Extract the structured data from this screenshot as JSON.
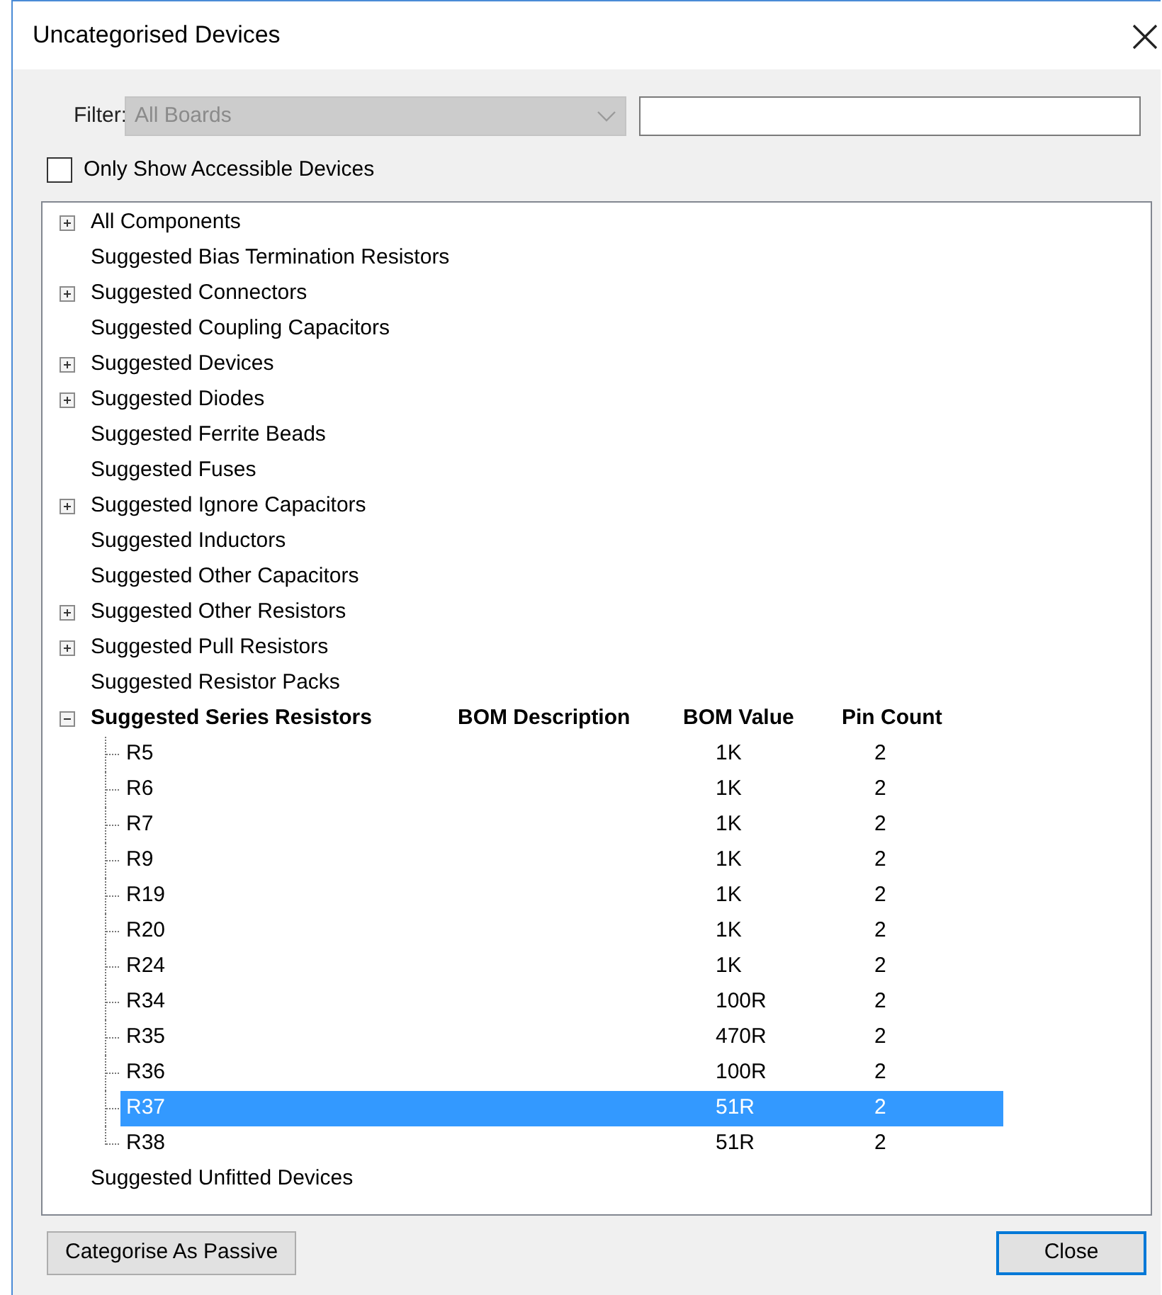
{
  "window": {
    "title": "Uncategorised Devices"
  },
  "filter": {
    "label": "Filter:",
    "board": {
      "value": "All Boards",
      "disabled": true
    }
  },
  "only_accessible": {
    "label": "Only Show Accessible Devices",
    "checked": false
  },
  "tree": {
    "items": [
      {
        "label": "All Components",
        "kind": "expandable",
        "expanded": false
      },
      {
        "label": "Suggested Bias Termination Resistors",
        "kind": "plain"
      },
      {
        "label": "Suggested Connectors",
        "kind": "expandable",
        "expanded": false
      },
      {
        "label": "Suggested Coupling Capacitors",
        "kind": "plain"
      },
      {
        "label": "Suggested Devices",
        "kind": "expandable",
        "expanded": false
      },
      {
        "label": "Suggested Diodes",
        "kind": "expandable",
        "expanded": false
      },
      {
        "label": "Suggested Ferrite Beads",
        "kind": "plain"
      },
      {
        "label": "Suggested Fuses",
        "kind": "plain"
      },
      {
        "label": "Suggested Ignore Capacitors",
        "kind": "expandable",
        "expanded": false
      },
      {
        "label": "Suggested Inductors",
        "kind": "plain"
      },
      {
        "label": "Suggested Other Capacitors",
        "kind": "plain"
      },
      {
        "label": "Suggested Other Resistors",
        "kind": "expandable",
        "expanded": false
      },
      {
        "label": "Suggested Pull Resistors",
        "kind": "expandable",
        "expanded": false
      },
      {
        "label": "Suggested Resistor Packs",
        "kind": "plain"
      },
      {
        "label": "Suggested Series Resistors",
        "kind": "expandable",
        "expanded": true,
        "columns": [
          "BOM Description",
          "BOM Value",
          "Pin Count"
        ],
        "children": [
          {
            "name": "R5",
            "bom_value": "1K",
            "pin_count": "2",
            "selected": false
          },
          {
            "name": "R6",
            "bom_value": "1K",
            "pin_count": "2",
            "selected": false
          },
          {
            "name": "R7",
            "bom_value": "1K",
            "pin_count": "2",
            "selected": false
          },
          {
            "name": "R9",
            "bom_value": "1K",
            "pin_count": "2",
            "selected": false
          },
          {
            "name": "R19",
            "bom_value": "1K",
            "pin_count": "2",
            "selected": false
          },
          {
            "name": "R20",
            "bom_value": "1K",
            "pin_count": "2",
            "selected": false
          },
          {
            "name": "R24",
            "bom_value": "1K",
            "pin_count": "2",
            "selected": false
          },
          {
            "name": "R34",
            "bom_value": "100R",
            "pin_count": "2",
            "selected": false
          },
          {
            "name": "R35",
            "bom_value": "470R",
            "pin_count": "2",
            "selected": false
          },
          {
            "name": "R36",
            "bom_value": "100R",
            "pin_count": "2",
            "selected": false
          },
          {
            "name": "R37",
            "bom_value": "51R",
            "pin_count": "2",
            "selected": true
          },
          {
            "name": "R38",
            "bom_value": "51R",
            "pin_count": "2",
            "selected": false
          }
        ]
      },
      {
        "label": "Suggested Unfitted Devices",
        "kind": "plain"
      }
    ]
  },
  "buttons": [
    {
      "label": "Categorise As Passive",
      "default": false
    },
    {
      "label": "Close",
      "default": true
    }
  ]
}
